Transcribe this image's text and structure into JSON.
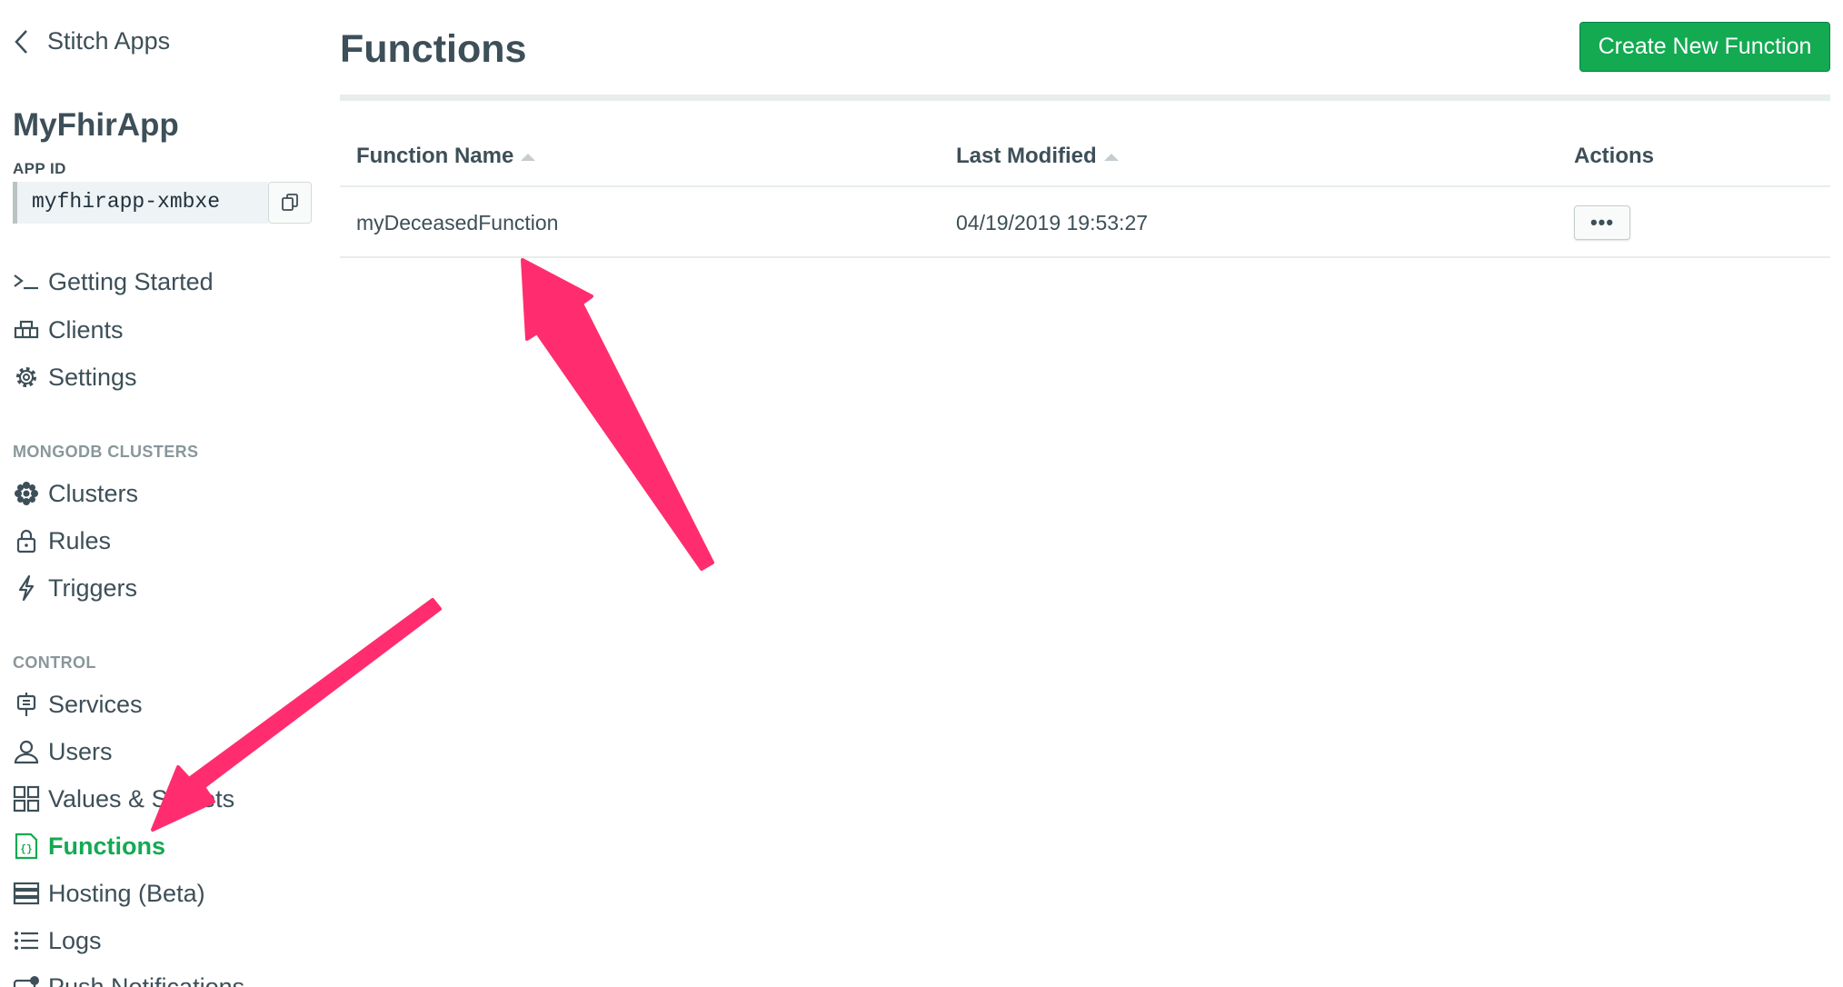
{
  "sidebar": {
    "back_label": "Stitch Apps",
    "app_name": "MyFhirApp",
    "app_id_label": "APP ID",
    "app_id_value": "myfhirapp-xmbxe",
    "items_top": [
      {
        "label": "Getting Started",
        "icon": "terminal-icon"
      },
      {
        "label": "Clients",
        "icon": "clients-icon"
      },
      {
        "label": "Settings",
        "icon": "gear-icon"
      }
    ],
    "section_clusters": "MONGODB CLUSTERS",
    "items_clusters": [
      {
        "label": "Clusters",
        "icon": "clusters-icon"
      },
      {
        "label": "Rules",
        "icon": "lock-icon"
      },
      {
        "label": "Triggers",
        "icon": "lightning-icon"
      }
    ],
    "section_control": "CONTROL",
    "items_control": [
      {
        "label": "Services",
        "icon": "plug-icon"
      },
      {
        "label": "Users",
        "icon": "user-icon"
      },
      {
        "label": "Values & Secrets",
        "icon": "grid-icon"
      },
      {
        "label": "Functions",
        "icon": "function-file-icon",
        "active": true
      },
      {
        "label": "Hosting (Beta)",
        "icon": "server-icon"
      },
      {
        "label": "Logs",
        "icon": "list-icon"
      },
      {
        "label": "Push Notifications",
        "icon": "push-icon"
      }
    ]
  },
  "main": {
    "title": "Functions",
    "create_button": "Create New Function",
    "columns": [
      "Function Name",
      "Last Modified",
      "Actions"
    ],
    "rows": [
      {
        "name": "myDeceasedFunction",
        "last_modified": "04/19/2019 19:53:27",
        "actions": "•••"
      }
    ]
  },
  "colors": {
    "accent_green": "#13aa52",
    "text": "#3d4f58",
    "annotation_arrow": "#ff2d6f"
  }
}
